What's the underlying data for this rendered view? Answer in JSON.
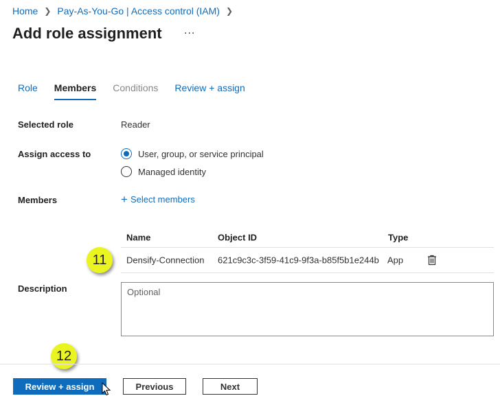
{
  "breadcrumb": {
    "home": "Home",
    "parent": "Pay-As-You-Go | Access control (IAM)"
  },
  "page": {
    "title": "Add role assignment",
    "more": "..."
  },
  "tabs": [
    {
      "label": "Role",
      "state": "normal"
    },
    {
      "label": "Members",
      "state": "active"
    },
    {
      "label": "Conditions",
      "state": "disabled"
    },
    {
      "label": "Review + assign",
      "state": "normal"
    }
  ],
  "form": {
    "selected_role_label": "Selected role",
    "selected_role_value": "Reader",
    "assign_access_label": "Assign access to",
    "options": [
      {
        "label": "User, group, or service principal",
        "checked": true
      },
      {
        "label": "Managed identity",
        "checked": false
      }
    ],
    "members_label": "Members",
    "select_members": "Select members",
    "description_label": "Description",
    "description_placeholder": "Optional"
  },
  "members_table": {
    "headers": [
      "Name",
      "Object ID",
      "Type"
    ],
    "rows": [
      {
        "name": "Densify-Connection",
        "object_id": "621c9c3c-3f59-41c9-9f3a-b85f5b1e244b",
        "type": "App"
      }
    ]
  },
  "markers": [
    "11",
    "12"
  ],
  "footer": {
    "review_assign": "Review + assign",
    "previous": "Previous",
    "next": "Next"
  },
  "colors": {
    "accent": "#0f6cbd",
    "marker": "#eaf421"
  }
}
